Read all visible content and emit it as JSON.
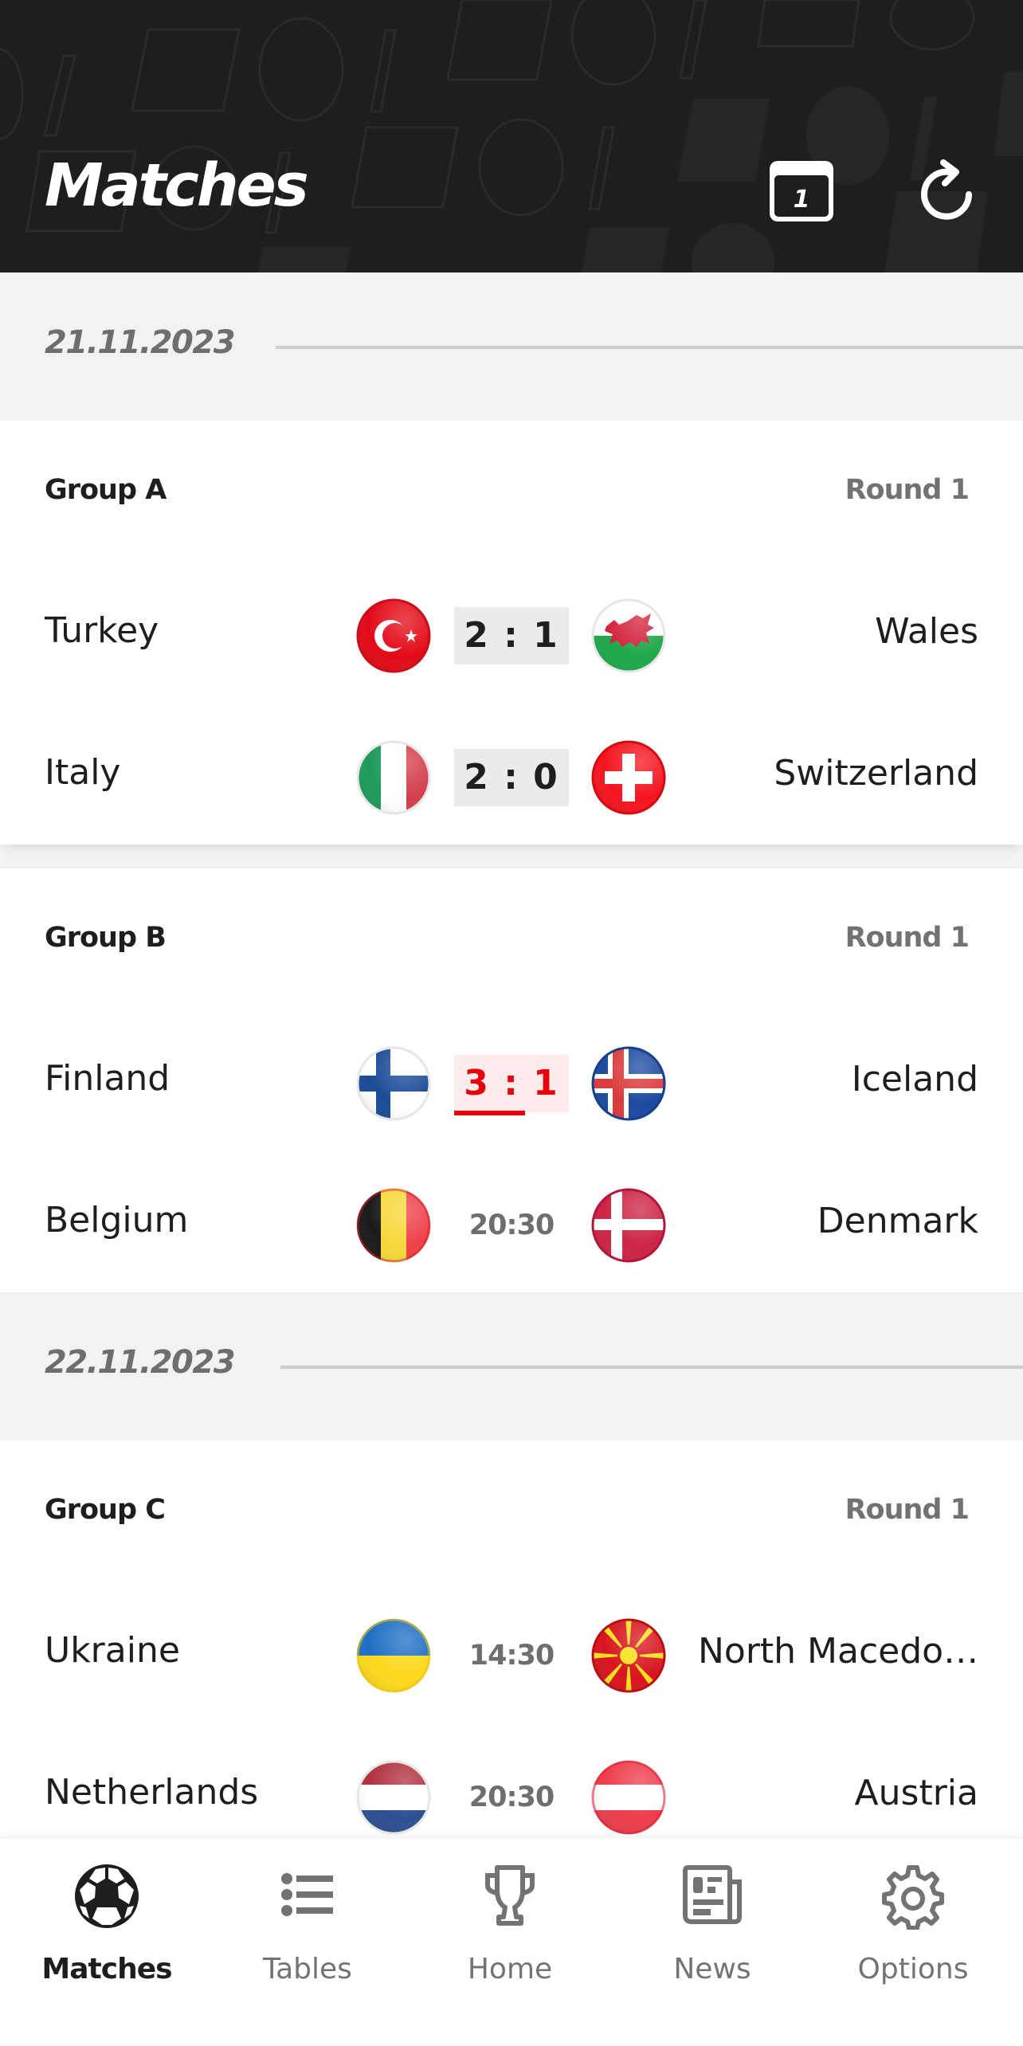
{
  "header": {
    "title": "Matches",
    "calendar_button": {
      "icon": "calendar-icon",
      "day": "1"
    },
    "refresh_button": {
      "icon": "refresh-icon"
    }
  },
  "days": [
    {
      "date": "21.11.2023",
      "groups": [
        {
          "name": "Group A",
          "round": "Round 1",
          "matches": [
            {
              "home": "Turkey",
              "away": "Wales",
              "status": "finished",
              "score": "2 : 1",
              "home_flag": "turkey-flag",
              "away_flag": "wales-flag"
            },
            {
              "home": "Italy",
              "away": "Switzerland",
              "status": "finished",
              "score": "2 : 0",
              "home_flag": "italy-flag",
              "away_flag": "switzerland-flag"
            }
          ]
        },
        {
          "name": "Group B",
          "round": "Round 1",
          "matches": [
            {
              "home": "Finland",
              "away": "Iceland",
              "status": "live",
              "score": "3 : 1",
              "home_flag": "finland-flag",
              "away_flag": "iceland-flag"
            },
            {
              "home": "Belgium",
              "away": "Denmark",
              "status": "scheduled",
              "kickoff": "20:30",
              "home_flag": "belgium-flag",
              "away_flag": "denmark-flag"
            }
          ]
        }
      ]
    },
    {
      "date": "22.11.2023",
      "groups": [
        {
          "name": "Group C",
          "round": "Round 1",
          "matches": [
            {
              "home": "Ukraine",
              "away": "North Macedonia",
              "status": "scheduled",
              "kickoff": "14:30",
              "home_flag": "ukraine-flag",
              "away_flag": "north-macedonia-flag"
            },
            {
              "home": "Netherlands",
              "away": "Austria",
              "status": "scheduled",
              "kickoff": "20:30",
              "home_flag": "netherlands-flag",
              "away_flag": "austria-flag"
            }
          ]
        }
      ]
    }
  ],
  "colors": {
    "header_bg": "#1e1e1e",
    "live_red": "#e8000b",
    "live_bg": "#fdecec",
    "score_bg": "#ebebeb",
    "muted_text": "#6e6e6e"
  },
  "bottom_nav": {
    "active": "Matches",
    "items": [
      {
        "label": "Matches",
        "icon": "soccer-ball-icon"
      },
      {
        "label": "Tables",
        "icon": "list-icon"
      },
      {
        "label": "Home",
        "icon": "trophy-icon"
      },
      {
        "label": "News",
        "icon": "newspaper-icon"
      },
      {
        "label": "Options",
        "icon": "gear-icon"
      }
    ]
  }
}
